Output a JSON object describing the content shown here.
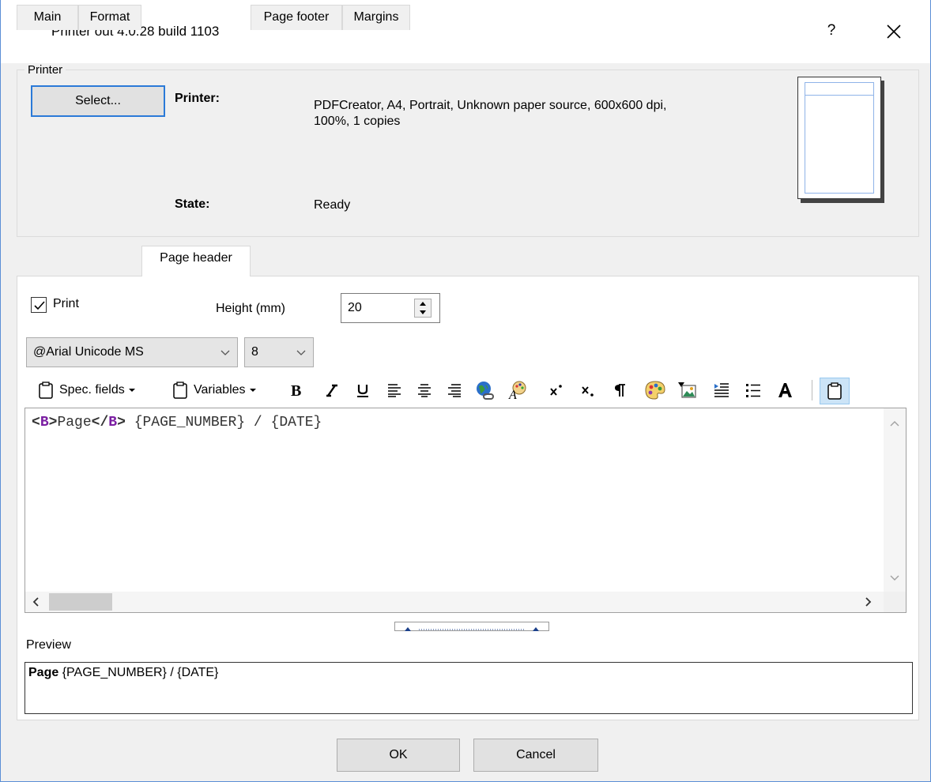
{
  "window": {
    "title": "Printer out 4.0.28 build 1103",
    "help_glyph": "?"
  },
  "printer_group": {
    "label": "Printer",
    "select_button": "Select...",
    "printer_label": "Printer:",
    "printer_value_line1": "PDFCreator, A4, Portrait, Unknown paper source, 600x600 dpi,",
    "printer_value_line2": "100%, 1 copies",
    "state_label": "State:",
    "state_value": "Ready"
  },
  "tabs": [
    {
      "label": "Main"
    },
    {
      "label": "Format"
    },
    {
      "label": "Page header"
    },
    {
      "label": "Page footer"
    },
    {
      "label": "Margins"
    }
  ],
  "active_tab": "Page header",
  "page_header": {
    "print_label": "Print",
    "print_checked": true,
    "height_label": "Height (mm)",
    "height_value": "20",
    "font_name": "@Arial Unicode MS",
    "font_size": "8"
  },
  "toolbar": {
    "spec_fields": "Spec. fields",
    "variables": "Variables"
  },
  "editor": {
    "tag_open_lt": "<",
    "tag_open_name": "B",
    "tag_open_gt": ">",
    "word": "Page",
    "tag_close_lt": "</",
    "tag_close_name": "B",
    "tag_close_gt": ">",
    "rest": " {PAGE_NUMBER} / {DATE}"
  },
  "preview": {
    "label": "Preview",
    "bold_part": "Page",
    "rest": " {PAGE_NUMBER} / {DATE}"
  },
  "buttons": {
    "ok": "OK",
    "cancel": "Cancel"
  },
  "colors": {
    "accent": "#2b7ad8",
    "tag": "#7b1fa2"
  }
}
